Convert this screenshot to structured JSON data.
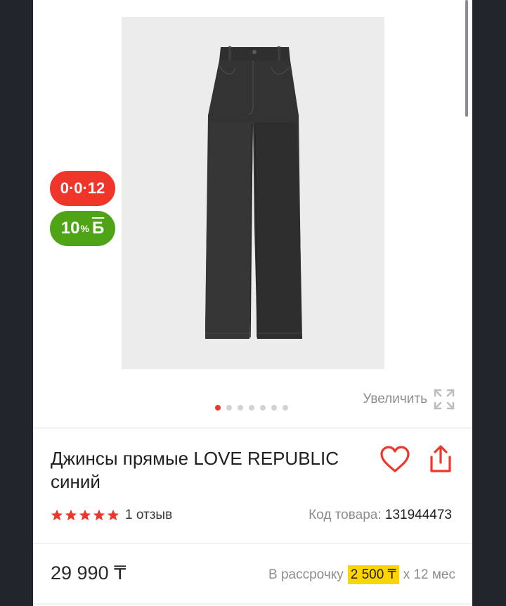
{
  "badges": {
    "installment": "0·0·12",
    "bonus_value": "10",
    "bonus_percent": "%",
    "bonus_currency": "Б"
  },
  "gallery": {
    "zoom_label": "Увеличить",
    "image_count": 7,
    "active_index": 0
  },
  "product": {
    "title": "Джинсы прямые LOVE REPUBLIC синий",
    "reviews_label": "1 отзыв",
    "rating": 5,
    "sku_label": "Код товара:",
    "sku_value": "131944473"
  },
  "pricing": {
    "price": "29 990 ₸",
    "installment_label": "В рассрочку",
    "installment_amount": "2 500 ₸",
    "installment_term": "х 12 мес"
  },
  "colors": {
    "accent_red": "#f0352b",
    "bonus_green": "#4fa416",
    "installment_highlight": "#ffd400"
  }
}
